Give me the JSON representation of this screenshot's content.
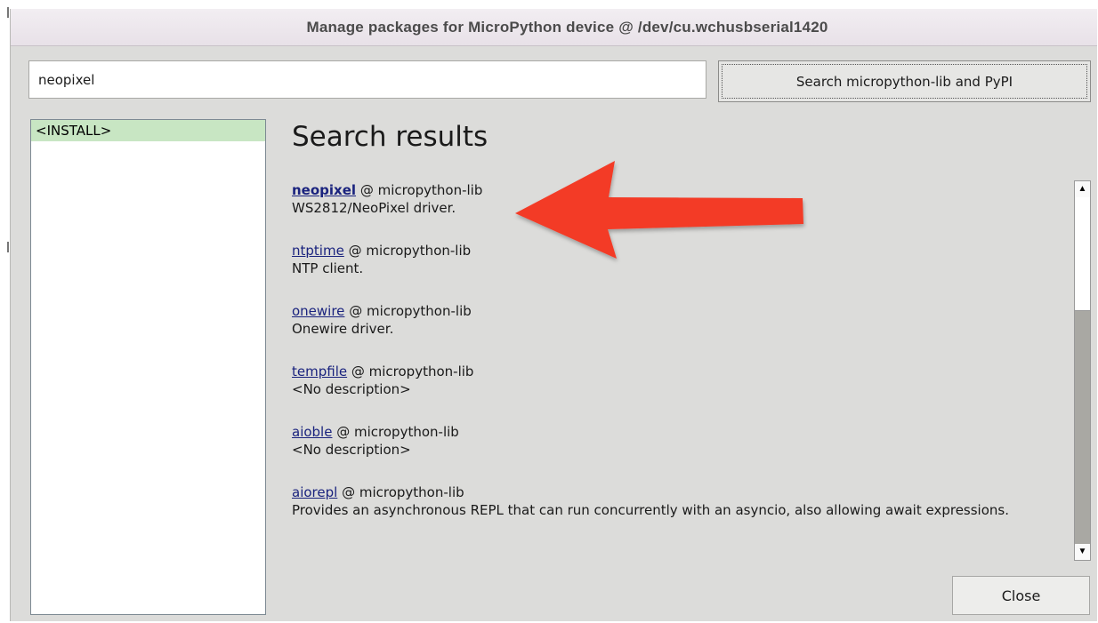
{
  "window": {
    "title": "Manage packages for MicroPython device @ /dev/cu.wchusbserial1420"
  },
  "search": {
    "value": "neopixel",
    "button_label": "Search micropython-lib and PyPI"
  },
  "sidebar": {
    "items": [
      {
        "label": "<INSTALL>",
        "selected": true
      }
    ]
  },
  "results": {
    "heading": "Search results",
    "items": [
      {
        "name": "neopixel",
        "source": "@ micropython-lib",
        "description": "WS2812/NeoPixel driver."
      },
      {
        "name": "ntptime",
        "source": "@ micropython-lib",
        "description": "NTP client."
      },
      {
        "name": "onewire",
        "source": "@ micropython-lib",
        "description": "Onewire driver."
      },
      {
        "name": "tempfile",
        "source": "@ micropython-lib",
        "description": "<No description>"
      },
      {
        "name": "aioble",
        "source": "@ micropython-lib",
        "description": "<No description>"
      },
      {
        "name": "aiorepl",
        "source": "@ micropython-lib",
        "description": "Provides an asynchronous REPL that can run concurrently with an asyncio, also allowing await expressions."
      }
    ]
  },
  "footer": {
    "close_label": "Close"
  },
  "icons": {
    "scroll_up": "up-arrow",
    "scroll_down": "down-arrow",
    "annotation": "red-left-arrow"
  },
  "colors": {
    "selection": "#c8e6c3",
    "link": "#1a237e",
    "annotation": "#f33a26"
  }
}
